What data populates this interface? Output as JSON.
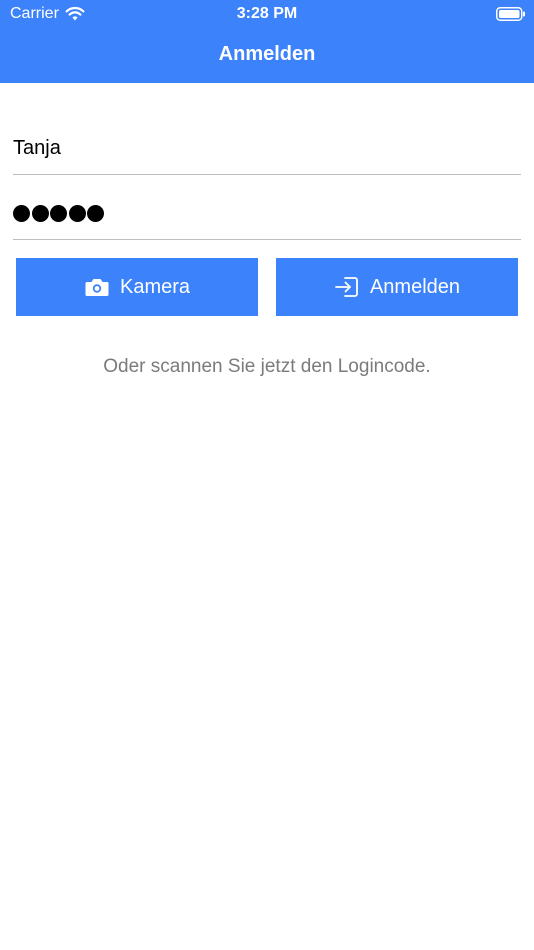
{
  "status_bar": {
    "carrier": "Carrier",
    "time": "3:28 PM"
  },
  "nav": {
    "title": "Anmelden"
  },
  "form": {
    "username_value": "Tanja",
    "password_masked_count": 5
  },
  "buttons": {
    "camera_label": "Kamera",
    "login_label": "Anmelden"
  },
  "hint": "Oder scannen Sie jetzt den Logincode.",
  "colors": {
    "accent": "#3c82fb",
    "hint_text": "#7b7b7b",
    "divider": "#bdbdbd"
  },
  "icons": {
    "wifi": "wifi-icon",
    "battery": "battery-icon",
    "camera": "camera-icon",
    "login": "login-icon"
  }
}
